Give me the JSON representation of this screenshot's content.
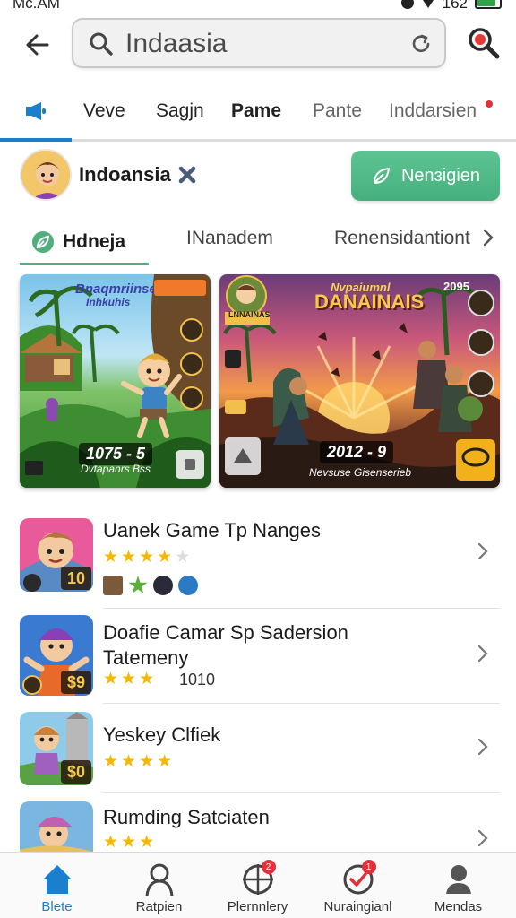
{
  "status_bar": {
    "time": "Mc.AM",
    "level": "162",
    "battery_fill": 0.85
  },
  "search": {
    "value": "Indaasia",
    "placeholder": "Indaasia"
  },
  "tabs": [
    {
      "label": ""
    },
    {
      "label": "Veve"
    },
    {
      "label": "Sagjn"
    },
    {
      "label": "Pame"
    },
    {
      "label": "Pante"
    },
    {
      "label": "Inddarsien"
    }
  ],
  "profile": {
    "name": "Indoansia",
    "follow_label": "Nenɜigien"
  },
  "sub_tabs": [
    {
      "label": "Hdneja"
    },
    {
      "label": "INanadem"
    },
    {
      "label": "Renensidantiont"
    }
  ],
  "banners": [
    {
      "title": "Bnaqmriinse",
      "subtitle": "Inhkuhis",
      "badge": "",
      "date": "1075 - 5",
      "caption": "Dvtapanrs Bss"
    },
    {
      "title": "Nvpaiumnl",
      "headline": "DANAINAIS",
      "tag": "2095",
      "avatar_label": "LNNAINAS",
      "date": "2012 - 9",
      "caption": "Nevsuse Gisenserieb"
    }
  ],
  "apps": [
    {
      "title": "Uanek Game Tp Nanges",
      "stars": 4,
      "badge": "10",
      "rating_text": ""
    },
    {
      "title": "Doafie Camar Sp Sadersion Tatemeny",
      "stars": 3,
      "badge": "$9",
      "rating_text": "1010"
    },
    {
      "title": "Yeskey Clfiek",
      "stars": 4,
      "badge": "$0",
      "rating_text": ""
    },
    {
      "title": "Rumding Satciaten",
      "stars": 3,
      "badge": "",
      "rating_text": ""
    }
  ],
  "bottom_nav": [
    {
      "label": "Blete",
      "icon": "home-icon",
      "badge": ""
    },
    {
      "label": "Ratpien",
      "icon": "person-icon",
      "badge": ""
    },
    {
      "label": "Plernnlery",
      "icon": "crosshair-icon",
      "badge": "2"
    },
    {
      "label": "Nuraingianl",
      "icon": "check-circle-icon",
      "badge": "1"
    },
    {
      "label": "Mendas",
      "icon": "account-icon",
      "badge": ""
    }
  ],
  "colors": {
    "accent": "#1b7fd0",
    "green": "#4fb07e",
    "star": "#f5b800",
    "badge_red": "#e3303a"
  }
}
